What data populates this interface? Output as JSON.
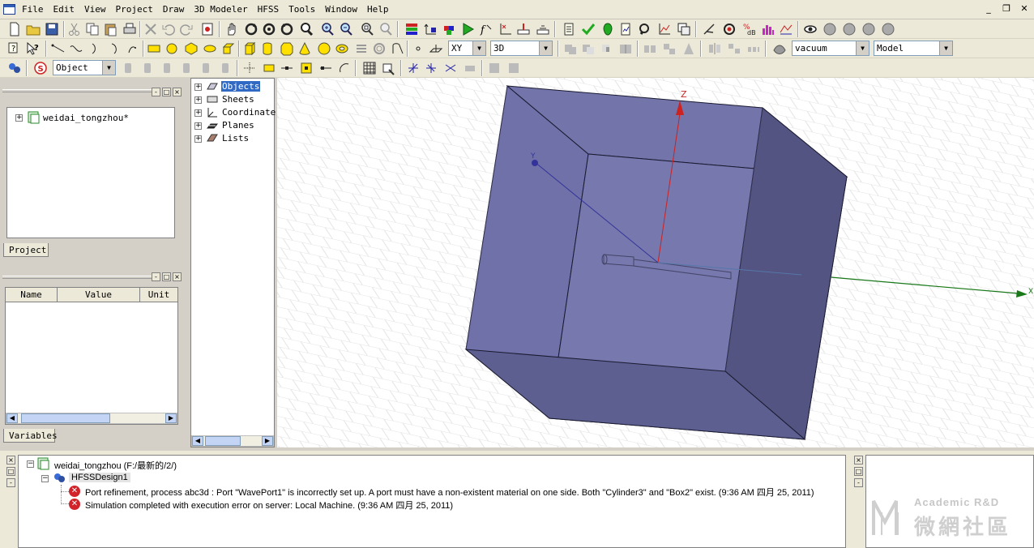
{
  "menu": [
    "File",
    "Edit",
    "View",
    "Project",
    "Draw",
    "3D Modeler",
    "HFSS",
    "Tools",
    "Window",
    "Help"
  ],
  "window_controls": [
    "_",
    "❐",
    "✕"
  ],
  "toolbar": {
    "selection_mode": "Object",
    "plane": "XY",
    "dimension": "3D",
    "material": "vacuum",
    "model_mode": "Model"
  },
  "project_panel": {
    "tree": [
      {
        "label": "weidai_tongzhou*"
      }
    ],
    "tab_label": "Project"
  },
  "history_tree": {
    "items": [
      "Objects",
      "Sheets",
      "Coordinate",
      "Planes",
      "Lists"
    ]
  },
  "variables_panel": {
    "columns": [
      "Name",
      "Value",
      "Unit"
    ],
    "tab_label": "Variables"
  },
  "viewport": {
    "axis_labels": {
      "x": "X",
      "y": "Y",
      "z": "Z"
    },
    "colors": {
      "box_front": "#7678ae",
      "box_side": "#535481",
      "box_top": "#6f71a8",
      "x_axis": "#187818",
      "z_axis": "#cc2222",
      "y_axis": "#333399"
    }
  },
  "message_manager": {
    "project": "weidai_tongzhou (F:/最新的/2/)",
    "design": "HFSSDesign1",
    "messages": [
      "Port refinement, process abc3d : Port \"WavePort1\" is incorrectly set up.  A port must have a non-existent material on one side.  Both \"Cylinder3\" and \"Box2\" exist. (9:36 AM  四月 25, 2011)",
      "Simulation completed with execution error on server: Local Machine. (9:36 AM  四月 25, 2011)"
    ]
  },
  "watermark": {
    "line1": "Academic R&D",
    "line2": "微網社區"
  }
}
